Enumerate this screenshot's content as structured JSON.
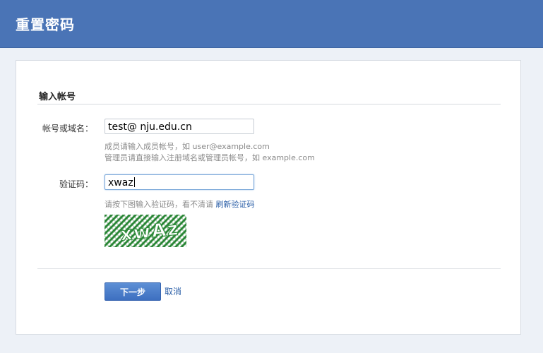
{
  "header": {
    "title": "重置密码"
  },
  "form": {
    "section_title": "输入帐号",
    "account": {
      "label": "帐号或域名：",
      "value": "test@ nju.edu.cn",
      "hint_member": "成员请输入成员帐号，如 user@example.com",
      "hint_admin": "管理员请直接输入注册域名或管理员帐号，如 example.com"
    },
    "captcha": {
      "label": "验证码：",
      "value": "xwaz",
      "hint": "请按下图输入验证码，看不清请",
      "refresh_link": "刷新验证码",
      "image_text": "xwAz"
    }
  },
  "actions": {
    "next_label": "下一步",
    "cancel_label": "取消"
  },
  "colors": {
    "header_bg": "#4a74b6",
    "page_bg": "#edf1f7",
    "button_bg": "#4a7cc9",
    "link": "#2a5ea7",
    "captcha_green": "#2e8b3a"
  }
}
